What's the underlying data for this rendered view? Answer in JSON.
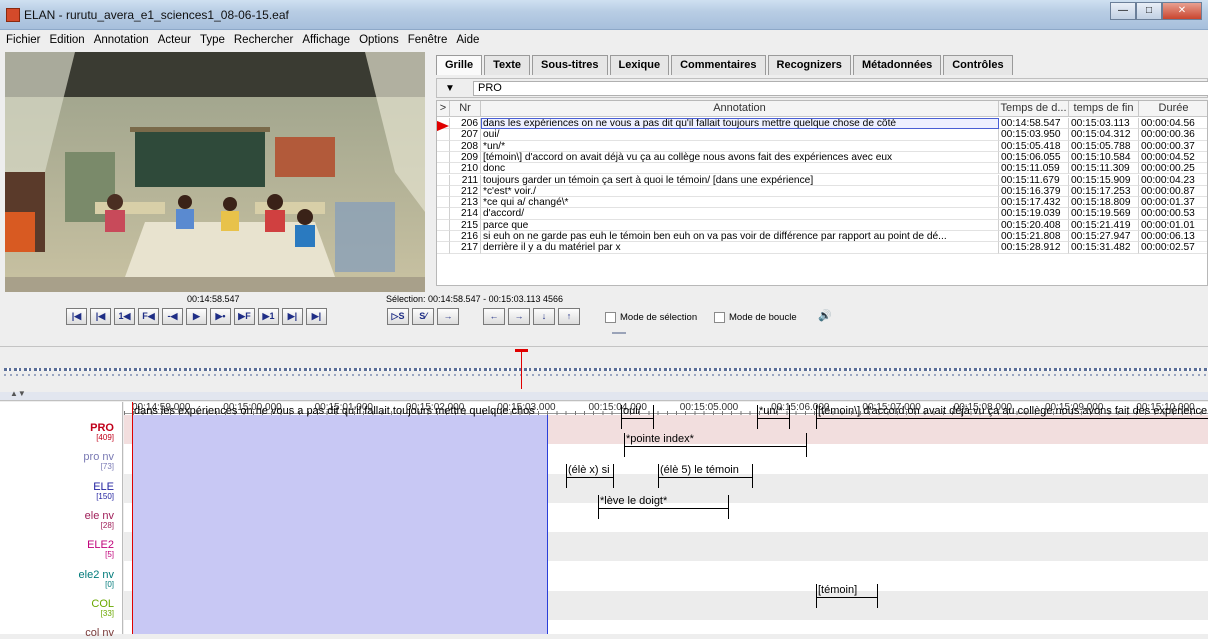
{
  "window": {
    "title": "ELAN - rurutu_avera_e1_sciences1_08-06-15.eaf",
    "min": "—",
    "max": "□",
    "close": "✕"
  },
  "menu": [
    "Fichier",
    "Edition",
    "Annotation",
    "Acteur",
    "Type",
    "Rechercher",
    "Affichage",
    "Options",
    "Fenêtre",
    "Aide"
  ],
  "tabs": [
    "Grille",
    "Texte",
    "Sous-titres",
    "Lexique",
    "Commentaires",
    "Recognizers",
    "Métadonnées",
    "Contrôles"
  ],
  "grid": {
    "tier": "PRO",
    "headers": {
      "arrow": ">",
      "nr": "Nr",
      "annotation": "Annotation",
      "begin": "Temps de d...",
      "end": "temps de fin",
      "dur": "Durée"
    },
    "rows": [
      {
        "nr": "206",
        "text": "dans les expériences on ne vous a pas dit qu'il fallait toujours mettre quelque chose de côté",
        "begin": "00:14:58.547",
        "end": "00:15:03.113",
        "dur": "00:00:04.56"
      },
      {
        "nr": "207",
        "text": "oui/",
        "begin": "00:15:03.950",
        "end": "00:15:04.312",
        "dur": "00:00:00.36"
      },
      {
        "nr": "208",
        "text": "*un/*",
        "begin": "00:15:05.418",
        "end": "00:15:05.788",
        "dur": "00:00:00.37"
      },
      {
        "nr": "209",
        "text": "[témoin\\] d'accord on avait déjà vu ça au collège nous avons fait des expériences avec eux",
        "begin": "00:15:06.055",
        "end": "00:15:10.584",
        "dur": "00:00:04.52"
      },
      {
        "nr": "210",
        "text": "donc",
        "begin": "00:15:11.059",
        "end": "00:15:11.309",
        "dur": "00:00:00.25"
      },
      {
        "nr": "211",
        "text": "toujours garder un témoin ça sert à quoi le témoin/ [dans une expérience]",
        "begin": "00:15:11.679",
        "end": "00:15:15.909",
        "dur": "00:00:04.23"
      },
      {
        "nr": "212",
        "text": "*c'est* voir./",
        "begin": "00:15:16.379",
        "end": "00:15:17.253",
        "dur": "00:00:00.87"
      },
      {
        "nr": "213",
        "text": "*ce qui a/ changé\\*",
        "begin": "00:15:17.432",
        "end": "00:15:18.809",
        "dur": "00:00:01.37"
      },
      {
        "nr": "214",
        "text": "d'accord/",
        "begin": "00:15:19.039",
        "end": "00:15:19.569",
        "dur": "00:00:00.53"
      },
      {
        "nr": "215",
        "text": "parce que",
        "begin": "00:15:20.408",
        "dur": "00:00:01.01",
        "end": "00:15:21.419"
      },
      {
        "nr": "216",
        "text": "si euh on ne garde pas euh le témoin ben euh on va pas voir de différence par rapport au point de dé...",
        "begin": "00:15:21.808",
        "end": "00:15:27.947",
        "dur": "00:00:06.13"
      },
      {
        "nr": "217",
        "text": "derrière il y a du matériel par x",
        "begin": "00:15:28.912",
        "end": "00:15:31.482",
        "dur": "00:00:02.57"
      }
    ]
  },
  "controls": {
    "current_time": "00:14:58.547",
    "selection": "Sélection: 00:14:58.547 - 00:15:03.113  4566",
    "buttons": [
      "|◀",
      "|◀",
      "1◀",
      "F◀",
      "-◀",
      "▶",
      "▶•",
      "▶F",
      "▶1",
      "▶|",
      "▶|"
    ],
    "sel_buttons": [
      "▷S",
      "S⁄",
      "→"
    ],
    "nav_buttons": [
      "←",
      "→",
      "↓",
      "↑"
    ],
    "mode_selection": "Mode de sélection",
    "mode_boucle": "Mode de boucle",
    "volume": "🔊"
  },
  "timeline": {
    "ticks": [
      "00:14:59.000",
      "00:15:00.000",
      "00:15:01.000",
      "00:15:02.000",
      "00:15:03.000",
      "00:15:04.000",
      "00:15:05.000",
      "00:15:06.000",
      "00:15:07.000",
      "00:15:08.000",
      "00:15:09.000",
      "00:15:10.000"
    ],
    "tiers": [
      {
        "name": "PRO",
        "count": "[409]",
        "color": "#c0001a"
      },
      {
        "name": "pro nv",
        "count": "[73]",
        "color": "#7a7ab4"
      },
      {
        "name": "ELE",
        "count": "[150]",
        "color": "#2222a0"
      },
      {
        "name": "ele nv",
        "count": "[28]",
        "color": "#a0205a"
      },
      {
        "name": "ELE2",
        "count": "[5]",
        "color": "#c0007a"
      },
      {
        "name": "ele2 nv",
        "count": "[0]",
        "color": "#007a7a"
      },
      {
        "name": "COL",
        "count": "[33]",
        "color": "#6aa800"
      },
      {
        "name": "col nv",
        "count": "",
        "color": "#7a3a3a"
      }
    ],
    "annotations": {
      "pro1": "dans les expériences on ne vous a pas dit qu'il fallait toujours mettre quelque chos",
      "pro2": "oui/",
      "pro3": "*un/*",
      "pro4": "[témoin\\] d'accord on avait déjà vu ça au collège nous avons fait des expérience",
      "pronv1": "*pointe index*",
      "ele1": "(élè x) si",
      "ele2": "(élè 5) le témoin",
      "elenv1": "*lève le doigt*",
      "col1": "[témoin]"
    }
  }
}
